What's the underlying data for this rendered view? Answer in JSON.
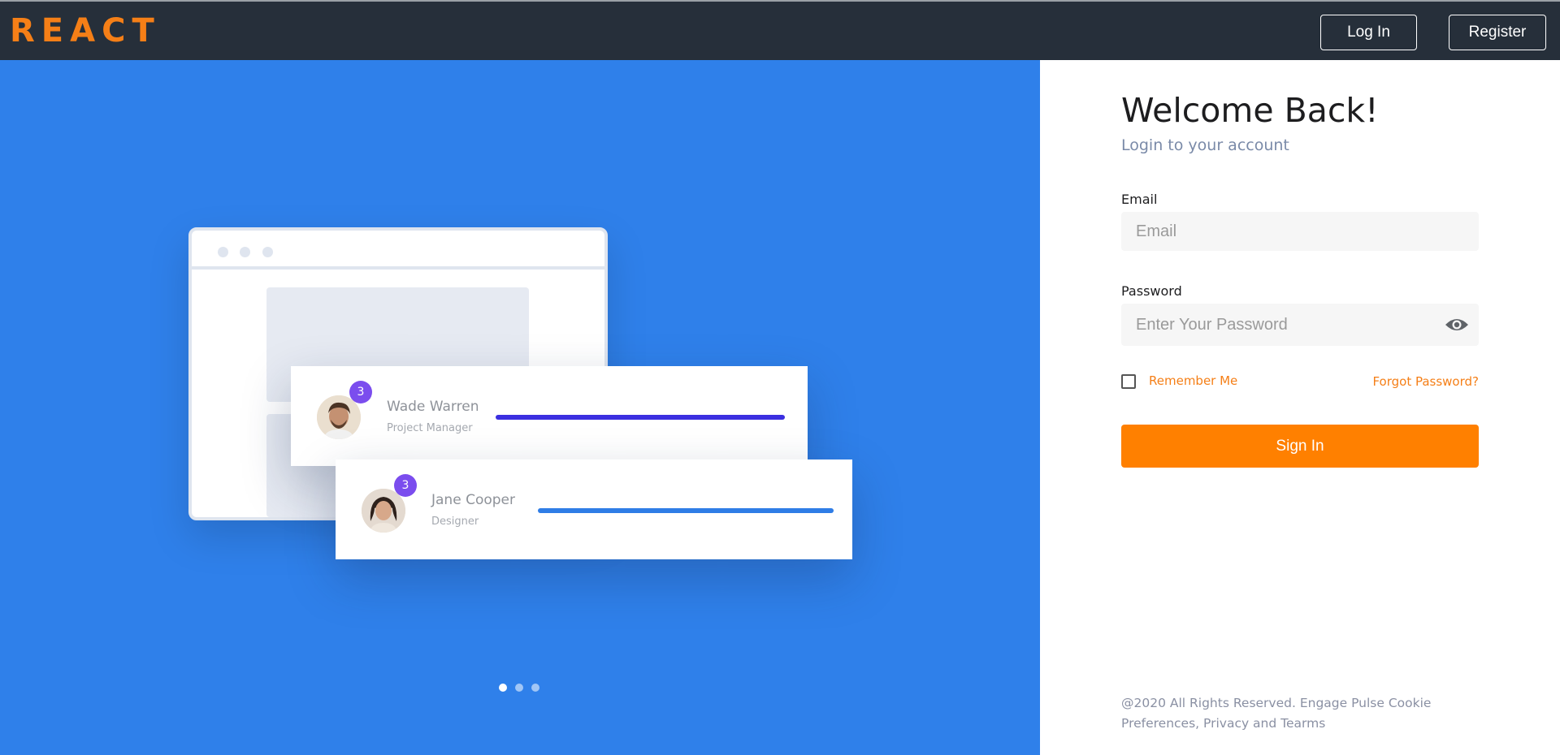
{
  "brand": {
    "logo_text": "REACT",
    "accent_color": "#f57f17"
  },
  "nav": {
    "login_label": "Log In",
    "register_label": "Register"
  },
  "hero": {
    "background_color": "#2f80ea",
    "cards": [
      {
        "name": "Wade Warren",
        "role": "Project Manager",
        "badge": "3",
        "bar_color": "#3b2fe0"
      },
      {
        "name": "Jane Cooper",
        "role": "Designer",
        "badge": "3",
        "bar_color": "#2f7de6"
      }
    ],
    "carousel": {
      "total": 3,
      "active_index": 0
    }
  },
  "login": {
    "title": "Welcome Back!",
    "subtitle": "Login to your account",
    "email_label": "Email",
    "email_placeholder": "Email",
    "password_label": "Password",
    "password_placeholder": "Enter Your Password",
    "password_toggle_icon": "eye-icon",
    "remember_label": "Remember Me",
    "remember_checked": false,
    "forgot_label": "Forgot Password?",
    "signin_label": "Sign In",
    "signin_color": "#ff8000",
    "footer_text": "@2020 All Rights Reserved. Engage Pulse Cookie Preferences, Privacy and Tearms"
  }
}
